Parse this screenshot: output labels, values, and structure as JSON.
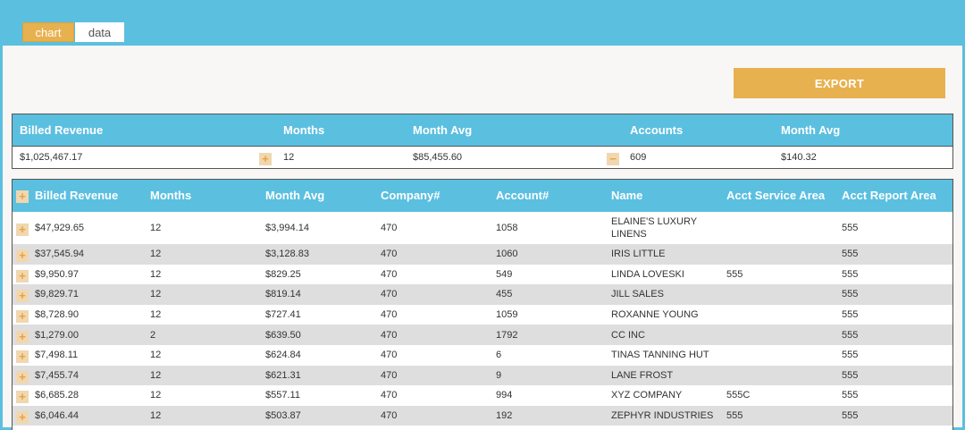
{
  "tabs": [
    {
      "label": "chart",
      "active": true
    },
    {
      "label": "data",
      "active": false
    }
  ],
  "export_label": "EXPORT",
  "summary": {
    "headers": [
      "Billed Revenue",
      "Months",
      "Month Avg",
      "Accounts",
      "Month Avg"
    ],
    "values": [
      "$1,025,467.17",
      "12",
      "$85,455.60",
      "609",
      "$140.32"
    ],
    "expand_symbol": "+",
    "collapse_symbol": "−"
  },
  "detail": {
    "header_plus": "+",
    "headers": [
      "Billed Revenue",
      "Months",
      "Month Avg",
      "Company#",
      "Account#",
      "Name",
      "Acct Service Area",
      "Acct Report Area"
    ],
    "rows": [
      {
        "billed": "$47,929.65",
        "months": "12",
        "avg": "$3,994.14",
        "company": "470",
        "account": "1058",
        "name": "ELAINE'S LUXURY LINENS",
        "service": "",
        "report": "555"
      },
      {
        "billed": "$37,545.94",
        "months": "12",
        "avg": "$3,128.83",
        "company": "470",
        "account": "1060",
        "name": "IRIS LITTLE",
        "service": "",
        "report": "555"
      },
      {
        "billed": "$9,950.97",
        "months": "12",
        "avg": "$829.25",
        "company": "470",
        "account": "549",
        "name": "LINDA LOVESKI",
        "service": "555",
        "report": "555"
      },
      {
        "billed": "$9,829.71",
        "months": "12",
        "avg": "$819.14",
        "company": "470",
        "account": "455",
        "name": "JILL SALES",
        "service": "",
        "report": "555"
      },
      {
        "billed": "$8,728.90",
        "months": "12",
        "avg": "$727.41",
        "company": "470",
        "account": "1059",
        "name": "ROXANNE YOUNG",
        "service": "",
        "report": "555"
      },
      {
        "billed": "$1,279.00",
        "months": "2",
        "avg": "$639.50",
        "company": "470",
        "account": "1792",
        "name": "CC INC",
        "service": "",
        "report": "555"
      },
      {
        "billed": "$7,498.11",
        "months": "12",
        "avg": "$624.84",
        "company": "470",
        "account": "6",
        "name": "TINAS TANNING HUT",
        "service": "",
        "report": "555"
      },
      {
        "billed": "$7,455.74",
        "months": "12",
        "avg": "$621.31",
        "company": "470",
        "account": "9",
        "name": "LANE FROST",
        "service": "",
        "report": "555"
      },
      {
        "billed": "$6,685.28",
        "months": "12",
        "avg": "$557.11",
        "company": "470",
        "account": "994",
        "name": "XYZ COMPANY",
        "service": "555C",
        "report": "555"
      },
      {
        "billed": "$6,046.44",
        "months": "12",
        "avg": "$503.87",
        "company": "470",
        "account": "192",
        "name": "ZEPHYR INDUSTRIES",
        "service": "555",
        "report": "555"
      }
    ],
    "row_plus": "+"
  }
}
